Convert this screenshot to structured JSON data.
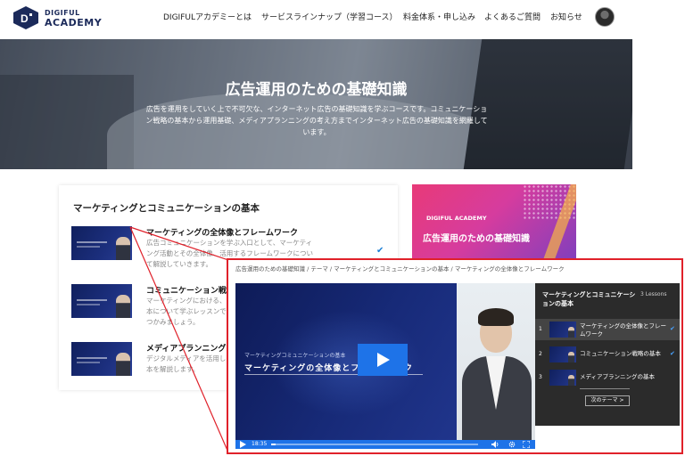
{
  "header": {
    "logo_top": "DIGIFUL",
    "logo_bottom": "ACADEMY",
    "nav": [
      "DIGIFULアカデミーとは",
      "サービスラインナップ（学習コース）",
      "料金体系・申し込み",
      "よくあるご質問",
      "お知らせ"
    ]
  },
  "hero": {
    "title": "広告運用のための基礎知識",
    "description": "広告を運用をしていく上で不可欠な、インターネット広告の基礎知識を学ぶコースです。コミュニケーション戦略の基本から運用基礎、メディアプランニングの考え方までインターネット広告の基礎知識を網羅しています。"
  },
  "section": {
    "title": "マーケティングとコミュニケーションの基本",
    "lessons": [
      {
        "title": "マーケティングの全体像とフレームワーク",
        "description": "広告コミュニケーションを学ぶ入口として、マーケティング活動とその全体像、活用するフレームワークについて解説していきます。"
      },
      {
        "title": "コミュニケーション戦略",
        "description": "マーケティングにおける、コミュニケーション戦略の基本について学ぶレッスンです。ユーザーの購買の流れをつかみましょう。"
      },
      {
        "title": "メディアプランニングの",
        "description": "デジタルメディアを活用したメディアプランニングの基本を解説します。"
      }
    ]
  },
  "banner": {
    "logo": "DIGIFUL ACADEMY",
    "title": "広告運用のための基礎知識"
  },
  "player": {
    "breadcrumb": "広告運用のための基礎知識 / テーマ / マーケティングとコミュニケーションの基本 / マーケティングの全体像とフレームワーク",
    "slide_subtitle": "マーケティングコミュニケーションの基本",
    "slide_title": "マーケティングの全体像とフレームワーク",
    "time": "18:35",
    "progress": 0.02,
    "sidebar_title": "マーケティングとコミュニケーションの基本",
    "lesson_count": "3 Lessons",
    "items": [
      {
        "num": "1",
        "label": "マーケティングの全体像とフレームワーク",
        "done": true
      },
      {
        "num": "2",
        "label": "コミュニケーション戦略の基本",
        "done": true
      },
      {
        "num": "3",
        "label": "メディアプランニングの基本",
        "done": false
      }
    ],
    "next_button": "次のテーマ >"
  },
  "colors": {
    "accent": "#1e73e8",
    "highlight_border": "#e0212a",
    "brand_navy": "#1b2a5a"
  }
}
